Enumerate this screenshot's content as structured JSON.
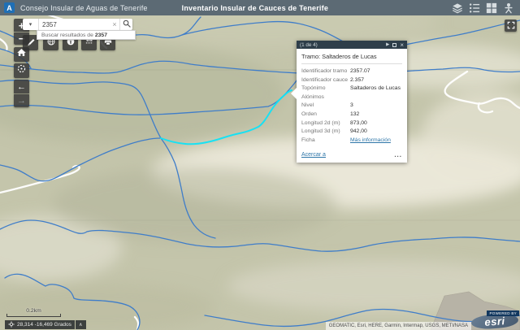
{
  "header": {
    "logo_glyph": "A",
    "title_left": "Consejo Insular de Aguas de Tenerife",
    "title_right": "Inventario Insular de Cauces de Tenerife",
    "icons": [
      "layers-icon",
      "legend-icon",
      "basemap-gallery-icon",
      "person-icon"
    ]
  },
  "search": {
    "value": "2357",
    "caret": "▾",
    "clear": "×",
    "suggestion_prefix": "Buscar resultados de",
    "suggestion_term": "2357"
  },
  "toolbar": {
    "buttons": [
      "draw",
      "globe",
      "about",
      "measurement",
      "print"
    ]
  },
  "zoom_controls": {
    "zoom_in": "+",
    "zoom_out": "−",
    "back": "←",
    "forward": "→"
  },
  "popup": {
    "pager": "(1 de 4)",
    "next": "▶",
    "close": "×",
    "title": "Tramo: Saltaderos de Lucas",
    "fields": [
      {
        "label": "Identificador tramo",
        "value": "2357.07"
      },
      {
        "label": "Identificador cauce",
        "value": "2.357"
      },
      {
        "label": "Topónimo",
        "value": "Saltaderos de Lucas"
      },
      {
        "label": "Alónimos",
        "value": ""
      },
      {
        "label": "Nivel",
        "value": "3"
      },
      {
        "label": "Orden",
        "value": "132"
      },
      {
        "label": "Longitud 2d (m)",
        "value": "873,00"
      },
      {
        "label": "Longitud 3d (m)",
        "value": "942,00"
      }
    ],
    "ficha": {
      "label": "Ficha",
      "link_text": "Más información"
    },
    "zoom_to": "Acercar a",
    "more": "..."
  },
  "statusbar": {
    "scale_label": "0.2km",
    "coordinates": "28,314 -16,469 Grados",
    "caret_up": "∧"
  },
  "attribution": {
    "sources": "GEOMATIC, Esri, HERE, Garmin, Intermap, USGS, METI/NASA",
    "powered_by": "POWERED BY",
    "brand": "esri"
  },
  "colors": {
    "stream": "#3f7dc9",
    "highlight": "#0fe3f7",
    "road": "#ffffff",
    "header_bg": "#5c6a74",
    "popup_header_bg": "#2e3e4a",
    "link": "#2e76a8"
  }
}
